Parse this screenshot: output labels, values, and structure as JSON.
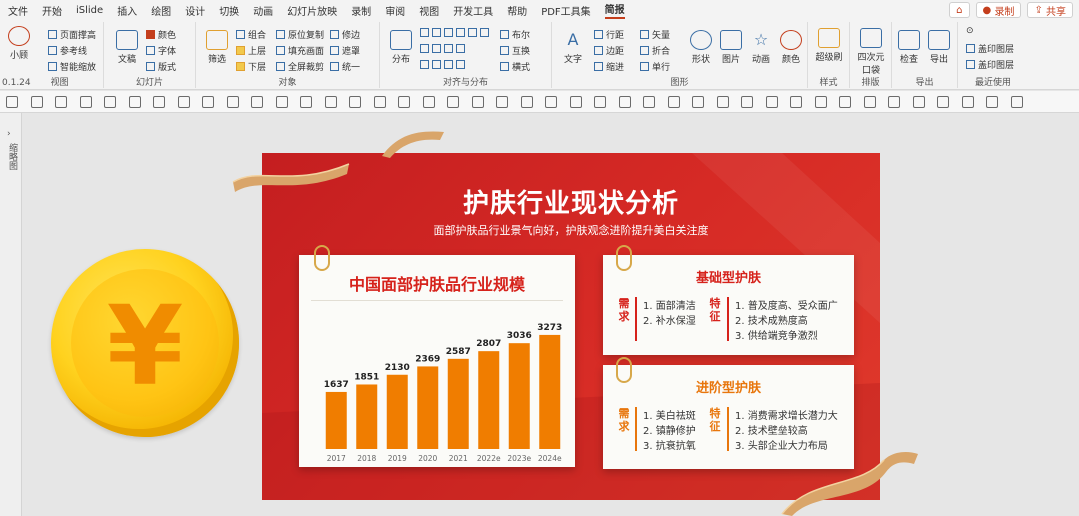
{
  "menu": {
    "items": [
      "文件",
      "开始",
      "iSlide",
      "插入",
      "绘图",
      "设计",
      "切换",
      "动画",
      "幻灯片放映",
      "录制",
      "审阅",
      "视图",
      "开发工具",
      "帮助",
      "PDF工具集",
      "简报"
    ],
    "active": "简报",
    "record_label": "录制",
    "share_label": "共享"
  },
  "ribbon": {
    "version": "0.1.24",
    "groups": {
      "view": "视图",
      "slide": "幻灯片",
      "object": "对象",
      "align": "对齐与分布",
      "shape": "图形",
      "style": "样式",
      "layout": "排版",
      "export": "导出",
      "recent": "最近使用"
    },
    "view_items": {
      "xiaoqiao": "小顾",
      "page_margin": "页面撑高",
      "guide": "参考线",
      "smart_zoom": "智能缩放"
    },
    "slide_items": {
      "text_doc": "文稿",
      "color": "颜色",
      "font": "字体",
      "layout": "版式"
    },
    "object_items": {
      "filter": "筛选",
      "combine": "组合",
      "up": "上层",
      "down": "下层",
      "orig_copy": "原位复制",
      "fill_pic": "填充画面",
      "full_crop": "全屏裁剪",
      "trim": "修边",
      "mask": "遮罩",
      "unify": "统一"
    },
    "align_items": {
      "distribute": "分布",
      "layout": "布尔",
      "swap": "互换",
      "spacing": "横式"
    },
    "shape_items": {
      "text": "文字",
      "rows": "行距",
      "margin": "边距",
      "indent": "缩进",
      "vector": "矢量",
      "fold": "折合",
      "single": "单行",
      "shape": "形状",
      "picture": "图片",
      "animation": "动画",
      "color": "颜色"
    },
    "style_items": {
      "beauty": "超级刷"
    },
    "layout_items": {
      "quad": "四次元口袋"
    },
    "export_items": {
      "check": "检查",
      "export": "导出"
    },
    "recent_items": {
      "stamp1": "盖印图层",
      "stamp2": "盖印图层"
    }
  },
  "sidepanel": {
    "label": "缩略图"
  },
  "slide": {
    "title": "护肤行业现状分析",
    "subtitle": "面部护肤品行业景气向好，护肤观念进阶提升美白关注度",
    "card1": {
      "title": "中国面部护肤品行业规模"
    },
    "card2": {
      "title": "基础型护肤",
      "need_label": "需求",
      "needs": [
        "1.  面部清洁",
        "2.  补水保湿"
      ],
      "feature_label": "特征",
      "features": [
        "1.  普及度高、受众面广",
        "2.  技术成熟度高",
        "3.  供给端竞争激烈"
      ]
    },
    "card3": {
      "title": "进阶型护肤",
      "need_label": "需求",
      "needs": [
        "1.  美白祛斑",
        "2.  镇静修护",
        "3.  抗衰抗氧"
      ],
      "feature_label": "特征",
      "features": [
        "1.  消费需求增长潜力大",
        "2.  技术壁垒较高",
        "3.  头部企业大力布局"
      ]
    },
    "coin_symbol": "¥"
  },
  "chart_data": {
    "type": "bar",
    "title": "中国面部护肤品行业规模",
    "categories": [
      "2017",
      "2018",
      "2019",
      "2020",
      "2021",
      "2022e",
      "2023e",
      "2024e"
    ],
    "values": [
      1637,
      1851,
      2130,
      2369,
      2587,
      2807,
      3036,
      3273
    ],
    "ylim": [
      0,
      3500
    ],
    "bar_color": "#f07d00",
    "grid": false
  },
  "colors": {
    "accent_red": "#d6221b",
    "accent_orange": "#e8760c",
    "bar": "#f07d00"
  }
}
